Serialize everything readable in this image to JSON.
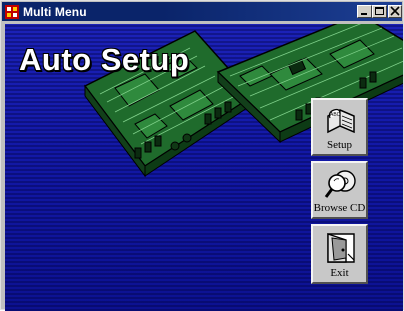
{
  "window": {
    "title": "Multi Menu"
  },
  "banner": {
    "title": "Auto Setup"
  },
  "menu": {
    "setup_label": "Setup",
    "browse_label": "Browse CD",
    "exit_label": "Exit"
  },
  "colors": {
    "titlebar": "#0a246a",
    "background_blue": "#1a1fb0",
    "board_green": "#1f6b2c",
    "button_face": "#c8c8c8"
  },
  "icons": {
    "app": "multi-menu-app-icon",
    "setup": "book-icon",
    "browse": "magnifier-cd-icon",
    "exit": "exit-door-icon"
  }
}
